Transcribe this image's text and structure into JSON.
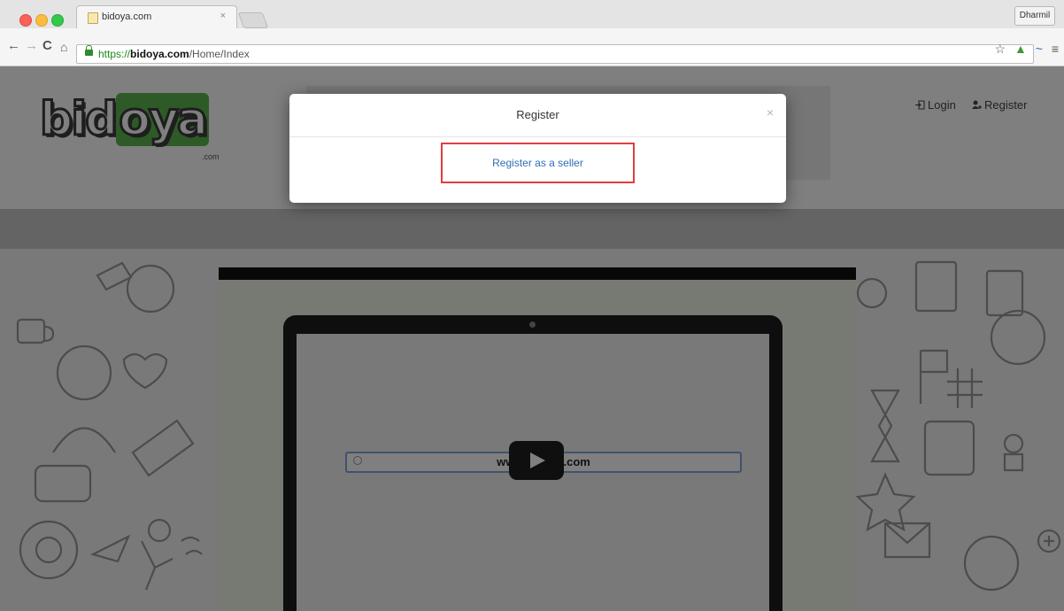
{
  "browser": {
    "tab_title": "bidoya.com",
    "tab_close": "×",
    "profile_name": "Dharmil",
    "url_scheme": "https://",
    "url_host": "bidoya.com",
    "url_path": "/Home/Index",
    "nav": {
      "back": "←",
      "forward": "→",
      "reload": "C",
      "home": "⌂"
    },
    "toolbar_icons": {
      "star": "☆",
      "drive": "▲",
      "extension": "~",
      "menu": "≡"
    }
  },
  "site": {
    "logo_text_1": "bid",
    "logo_text_2": "oya",
    "logo_suffix": ".com",
    "header_links": {
      "login": "Login",
      "register": "Register"
    }
  },
  "video": {
    "search_text": "www.bidoya.com"
  },
  "modal": {
    "title": "Register",
    "close": "×",
    "link": "Register as a seller"
  },
  "colors": {
    "highlight_border": "#e23d3d",
    "link": "#2f6eb5",
    "logo_green": "#5db44f"
  }
}
